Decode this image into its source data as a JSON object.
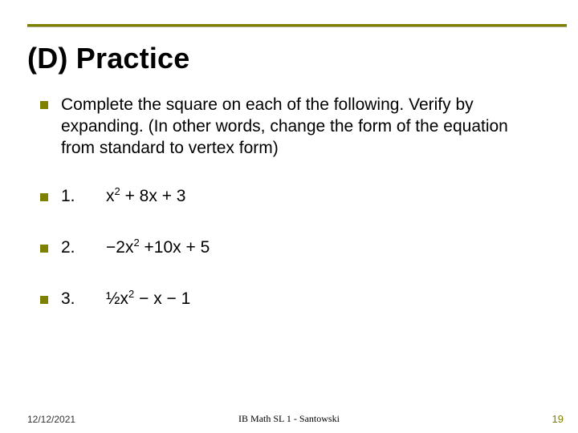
{
  "title": "(D) Practice",
  "intro": "Complete the square on each of the following. Verify by expanding. (In other words, change the form of the equation from standard to vertex form)",
  "items": [
    {
      "num": "1.",
      "expr_html": "x<sup>2</sup> + 8x + 3"
    },
    {
      "num": "2.",
      "expr_html": "−2x<sup>2</sup> +10x + 5"
    },
    {
      "num": "3.",
      "expr_html": "½x<sup>2</sup> − x − 1"
    }
  ],
  "footer": {
    "date": "12/12/2021",
    "center": "IB Math SL 1 - Santowski",
    "page": "19"
  }
}
